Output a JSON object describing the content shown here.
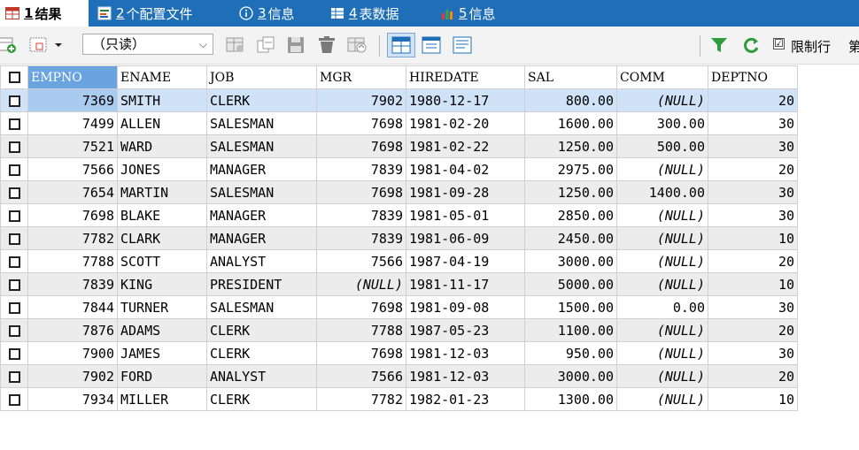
{
  "tabs": [
    {
      "num": "1",
      "label": " 结果",
      "icon": "grid-icon"
    },
    {
      "num": "2",
      "label": " 个配置文件",
      "icon": "profile-icon"
    },
    {
      "num": "3",
      "label": " 信息",
      "icon": "info-icon"
    },
    {
      "num": "4",
      "label": " 表数据",
      "icon": "table-icon"
    },
    {
      "num": "5",
      "label": " 信息",
      "icon": "chart-icon"
    }
  ],
  "toolbar": {
    "mode_select": "（只读）",
    "limit_label": "限制行",
    "limit_checked": "☑",
    "cut_label": "第"
  },
  "grid": {
    "columns": [
      "EMPNO",
      "ENAME",
      "JOB",
      "MGR",
      "HIREDATE",
      "SAL",
      "COMM",
      "DEPTNO"
    ],
    "rows": [
      [
        "7369",
        "SMITH",
        "CLERK",
        "7902",
        "1980-12-17",
        "800.00",
        "(NULL)",
        "20"
      ],
      [
        "7499",
        "ALLEN",
        "SALESMAN",
        "7698",
        "1981-02-20",
        "1600.00",
        "300.00",
        "30"
      ],
      [
        "7521",
        "WARD",
        "SALESMAN",
        "7698",
        "1981-02-22",
        "1250.00",
        "500.00",
        "30"
      ],
      [
        "7566",
        "JONES",
        "MANAGER",
        "7839",
        "1981-04-02",
        "2975.00",
        "(NULL)",
        "20"
      ],
      [
        "7654",
        "MARTIN",
        "SALESMAN",
        "7698",
        "1981-09-28",
        "1250.00",
        "1400.00",
        "30"
      ],
      [
        "7698",
        "BLAKE",
        "MANAGER",
        "7839",
        "1981-05-01",
        "2850.00",
        "(NULL)",
        "30"
      ],
      [
        "7782",
        "CLARK",
        "MANAGER",
        "7839",
        "1981-06-09",
        "2450.00",
        "(NULL)",
        "10"
      ],
      [
        "7788",
        "SCOTT",
        "ANALYST",
        "7566",
        "1987-04-19",
        "3000.00",
        "(NULL)",
        "20"
      ],
      [
        "7839",
        "KING",
        "PRESIDENT",
        "(NULL)",
        "1981-11-17",
        "5000.00",
        "(NULL)",
        "10"
      ],
      [
        "7844",
        "TURNER",
        "SALESMAN",
        "7698",
        "1981-09-08",
        "1500.00",
        "0.00",
        "30"
      ],
      [
        "7876",
        "ADAMS",
        "CLERK",
        "7788",
        "1987-05-23",
        "1100.00",
        "(NULL)",
        "20"
      ],
      [
        "7900",
        "JAMES",
        "CLERK",
        "7698",
        "1981-12-03",
        "950.00",
        "(NULL)",
        "30"
      ],
      [
        "7902",
        "FORD",
        "ANALYST",
        "7566",
        "1981-12-03",
        "3000.00",
        "(NULL)",
        "20"
      ],
      [
        "7934",
        "MILLER",
        "CLERK",
        "7782",
        "1982-01-23",
        "1300.00",
        "(NULL)",
        "10"
      ]
    ]
  }
}
